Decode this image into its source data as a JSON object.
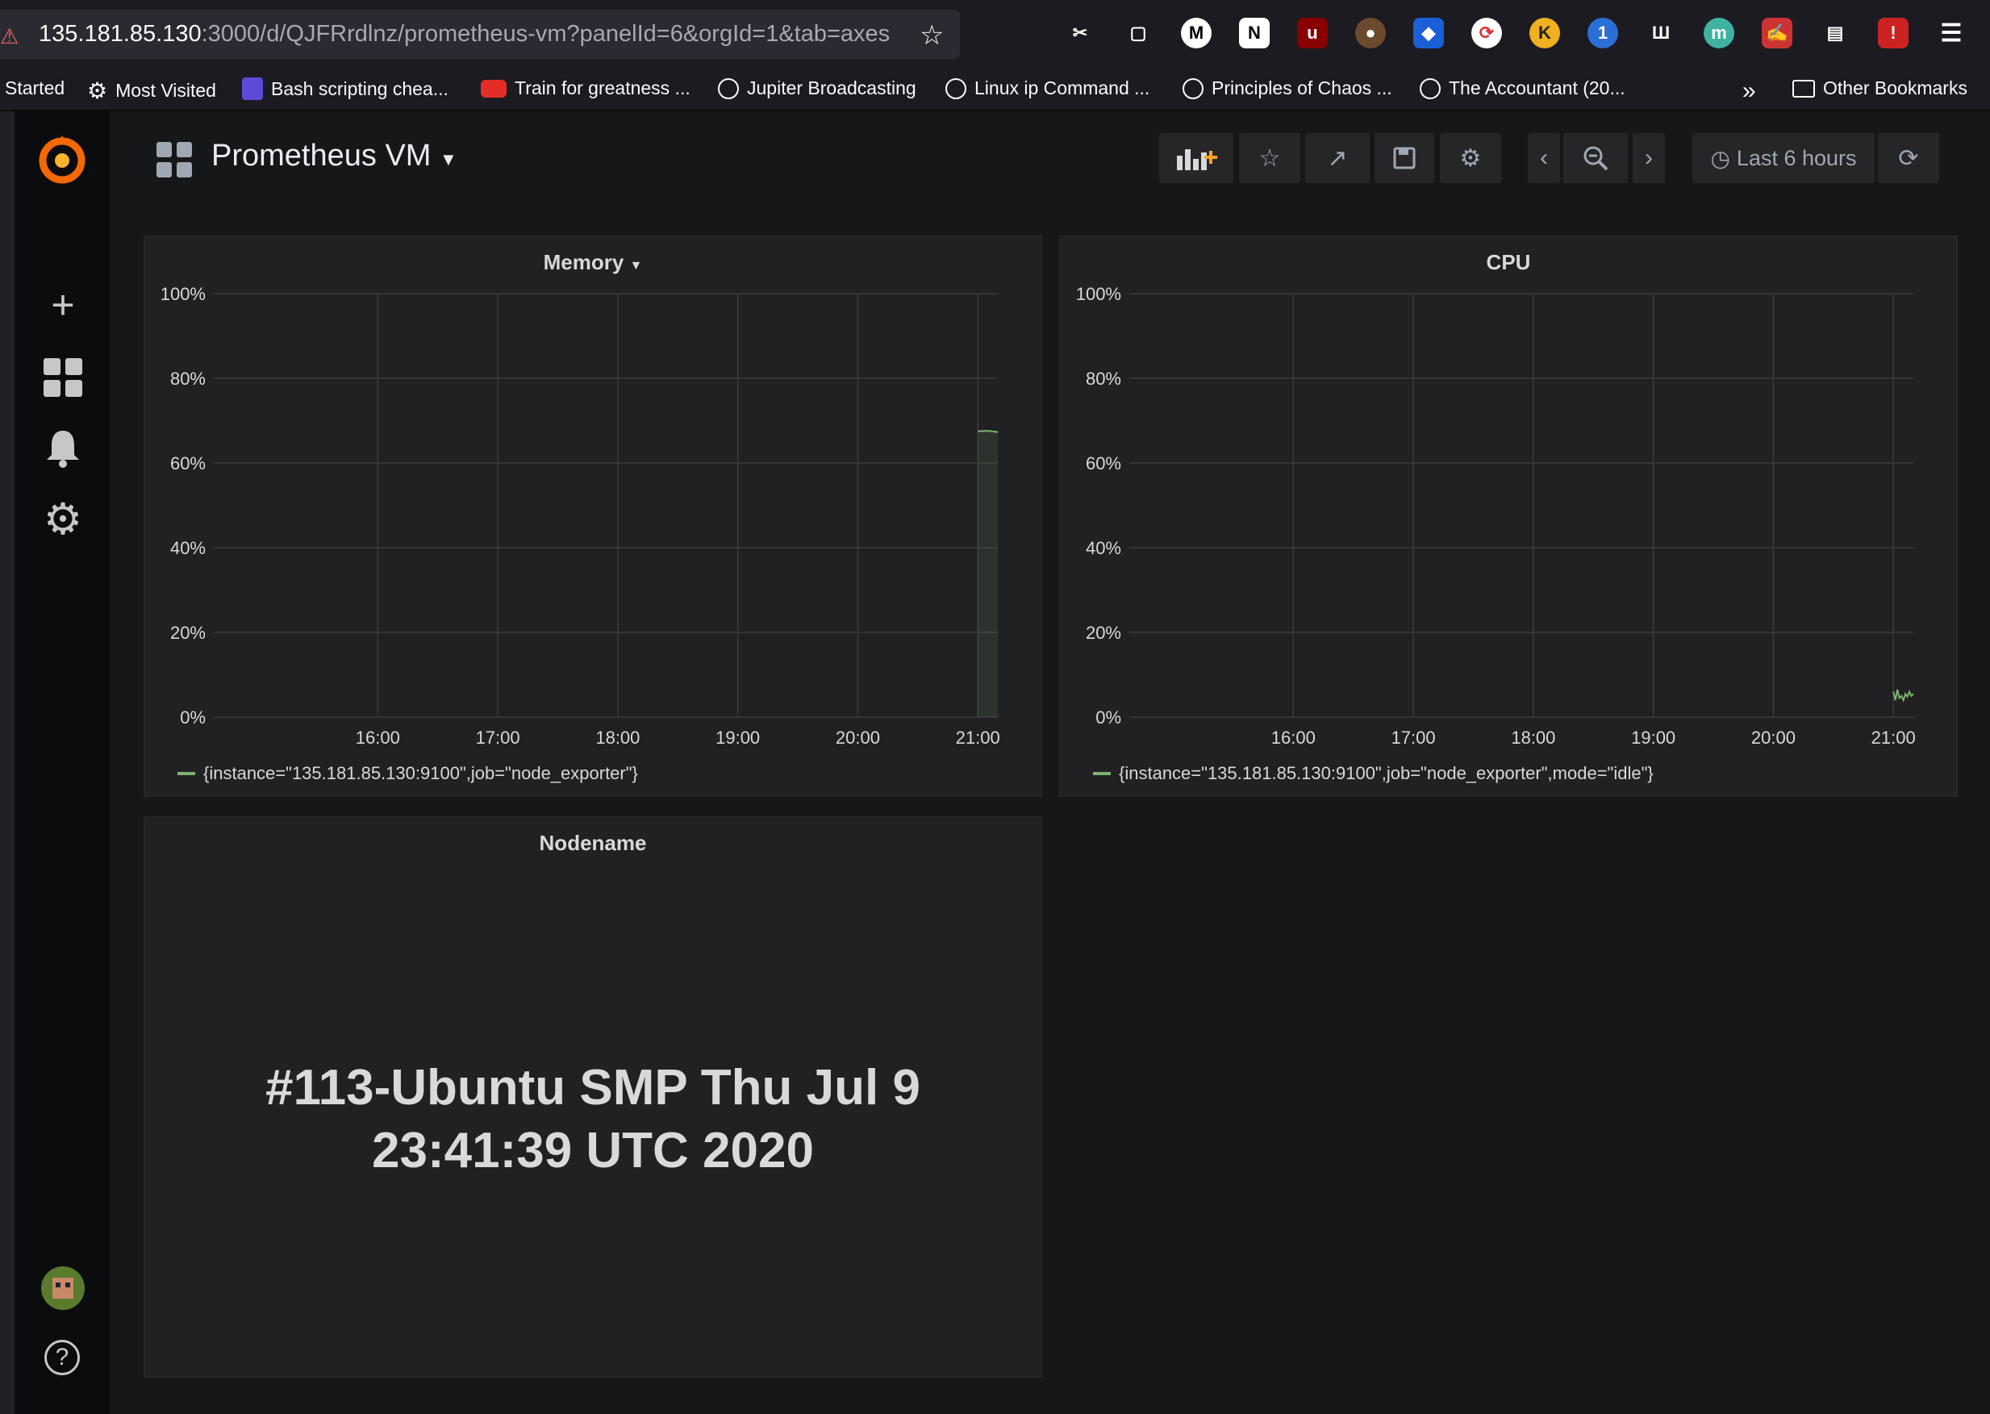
{
  "browser": {
    "url_host": "135.181.85.130",
    "url_rest": ":3000/d/QJFRrdlnz/prometheus-vm?panelId=6&orgId=1&tab=axes",
    "bookmarks": [
      {
        "label": "Started",
        "icon": "none"
      },
      {
        "label": "Most Visited",
        "icon": "gear-icon"
      },
      {
        "label": "Bash scripting chea...",
        "icon": "clip-icon"
      },
      {
        "label": "Train for greatness ...",
        "icon": "youtube-icon"
      },
      {
        "label": "Jupiter Broadcasting",
        "icon": "globe-icon"
      },
      {
        "label": "Linux ip Command ...",
        "icon": "globe-icon"
      },
      {
        "label": "Principles of Chaos ...",
        "icon": "globe-icon"
      },
      {
        "label": "The Accountant (20...",
        "icon": "globe-icon"
      }
    ],
    "other_bookmarks": "Other Bookmarks"
  },
  "dashboard": {
    "title": "Prometheus VM",
    "time_range": "Last 6 hours"
  },
  "panels": {
    "memory": {
      "title": "Memory",
      "legend": "{instance=\"135.181.85.130:9100\",job=\"node_exporter\"}"
    },
    "cpu": {
      "title": "CPU",
      "legend": "{instance=\"135.181.85.130:9100\",job=\"node_exporter\",mode=\"idle\"}"
    },
    "nodename": {
      "title": "Nodename",
      "value_line1": "#113-Ubuntu SMP Thu Jul 9",
      "value_line2": "23:41:39 UTC 2020"
    }
  },
  "chart_data": [
    {
      "type": "line",
      "title": "Memory",
      "x_ticks": [
        "16:00",
        "17:00",
        "18:00",
        "19:00",
        "20:00",
        "21:00"
      ],
      "y_ticks": [
        "0%",
        "20%",
        "40%",
        "60%",
        "80%",
        "100%"
      ],
      "ylim": [
        0,
        100
      ],
      "series": [
        {
          "legend": "{instance=\"135.181.85.130:9100\",job=\"node_exporter\"}",
          "color": "#7eb26d",
          "x": [
            "21:00",
            "21:05",
            "21:10"
          ],
          "y": [
            67.5,
            67.6,
            67.3
          ]
        }
      ]
    },
    {
      "type": "line",
      "title": "CPU",
      "x_ticks": [
        "16:00",
        "17:00",
        "18:00",
        "19:00",
        "20:00",
        "21:00"
      ],
      "y_ticks": [
        "0%",
        "20%",
        "40%",
        "60%",
        "80%",
        "100%"
      ],
      "ylim": [
        0,
        100
      ],
      "series": [
        {
          "legend": "{instance=\"135.181.85.130:9100\",job=\"node_exporter\",mode=\"idle\"}",
          "color": "#7eb26d",
          "x": [
            "21:00",
            "21:01",
            "21:02",
            "21:03",
            "21:04",
            "21:05",
            "21:06",
            "21:07",
            "21:08",
            "21:09",
            "21:10"
          ],
          "y": [
            6,
            4,
            6.5,
            4.5,
            5,
            4,
            5.5,
            4.8,
            6,
            5,
            5.5
          ]
        }
      ]
    }
  ]
}
